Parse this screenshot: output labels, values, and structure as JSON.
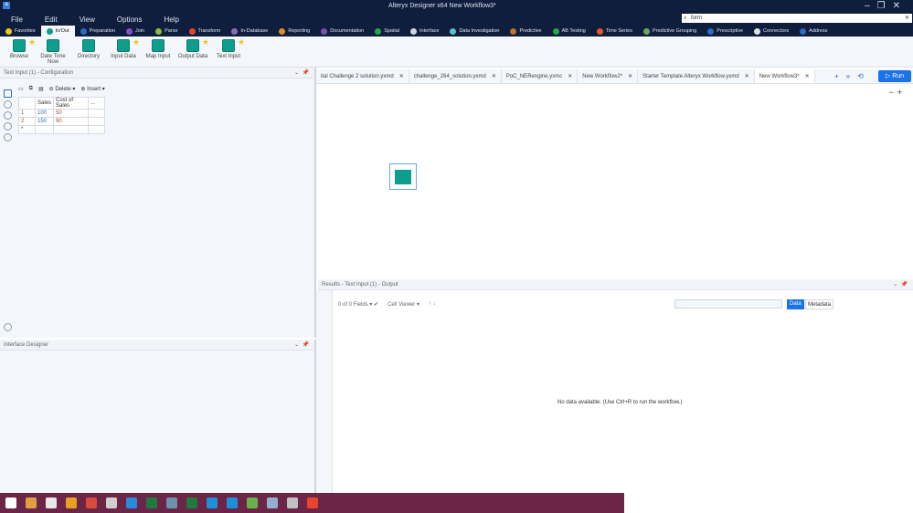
{
  "window": {
    "title": "Alteryx Designer x64   New Workflow3*",
    "logo": "a"
  },
  "menu": [
    "File",
    "Edit",
    "View",
    "Options",
    "Help"
  ],
  "search": {
    "value": "form"
  },
  "categories": [
    {
      "label": "Favorites",
      "color": "#f5c518"
    },
    {
      "label": "In/Out",
      "color": "#0f9e8e"
    },
    {
      "label": "Preparation",
      "color": "#2b6cc4"
    },
    {
      "label": "Join",
      "color": "#8a4fc4"
    },
    {
      "label": "Parse",
      "color": "#8dbf3b"
    },
    {
      "label": "Transform",
      "color": "#e8452c"
    },
    {
      "label": "In-Database",
      "color": "#8a6fb0"
    },
    {
      "label": "Reporting",
      "color": "#e08a2a"
    },
    {
      "label": "Documentation",
      "color": "#7a4fb0"
    },
    {
      "label": "Spatial",
      "color": "#27a845"
    },
    {
      "label": "Interface",
      "color": "#cfd6e0"
    },
    {
      "label": "Data Investigation",
      "color": "#5bc0c8"
    },
    {
      "label": "Predictive",
      "color": "#c0702a"
    },
    {
      "label": "AB Testing",
      "color": "#27a845"
    },
    {
      "label": "Time Series",
      "color": "#e8552c"
    },
    {
      "label": "Predictive Grouping",
      "color": "#6aa860"
    },
    {
      "label": "Prescriptive",
      "color": "#2b6cc4"
    },
    {
      "label": "Connectors",
      "color": "#e0e0e0"
    },
    {
      "label": "Address",
      "color": "#2b6cc4"
    }
  ],
  "tools": [
    {
      "label": "Browse",
      "fav": true
    },
    {
      "label": "Date Time Now",
      "fav": false
    },
    {
      "label": "Directory",
      "fav": false
    },
    {
      "label": "Input Data",
      "fav": true
    },
    {
      "label": "Map Input",
      "fav": false
    },
    {
      "label": "Output Data",
      "fav": true
    },
    {
      "label": "Text Input",
      "fav": true
    }
  ],
  "config": {
    "title": "Text Input (1) - Configuration",
    "delete": "Delete",
    "insert": "Insert",
    "headers": [
      "Sales",
      "Cost of Sales",
      "..."
    ],
    "rows": [
      {
        "n": "1",
        "sales": "100",
        "cost": "50"
      },
      {
        "n": "2",
        "sales": "150",
        "cost": "90"
      },
      {
        "n": "*",
        "sales": "",
        "cost": ""
      }
    ]
  },
  "interface_designer": {
    "title": "Interface Designer"
  },
  "tabs": [
    "ital Challenge 2 solution.yxmd",
    "challenge_264_solution.yxmd",
    "PoC_NERengine.yxmc",
    "New Workflow2*",
    "Starter Template Alteryx Workflow.yxmd",
    "New Workflow3*"
  ],
  "run_label": "Run",
  "results": {
    "title": "Results - Text Input (1) - Output",
    "fields": "0 of 0 Fields",
    "cell_viewer": "Cell Viewer",
    "data": "Data",
    "metadata": "Metadata",
    "empty": "No data available. (Use Ctrl+R to run the workflow.)"
  },
  "taskbar_colors": [
    "#ffffff",
    "#e0a040",
    "#e8e8e8",
    "#e8a020",
    "#d94b3b",
    "#d0d0d0",
    "#2a8cd8",
    "#1f7a3f",
    "#7090b0",
    "#1f7a3f",
    "#1e90d8",
    "#1e90d8",
    "#6ab04c",
    "#90b0d0",
    "#c0c0c0",
    "#e8452c"
  ]
}
